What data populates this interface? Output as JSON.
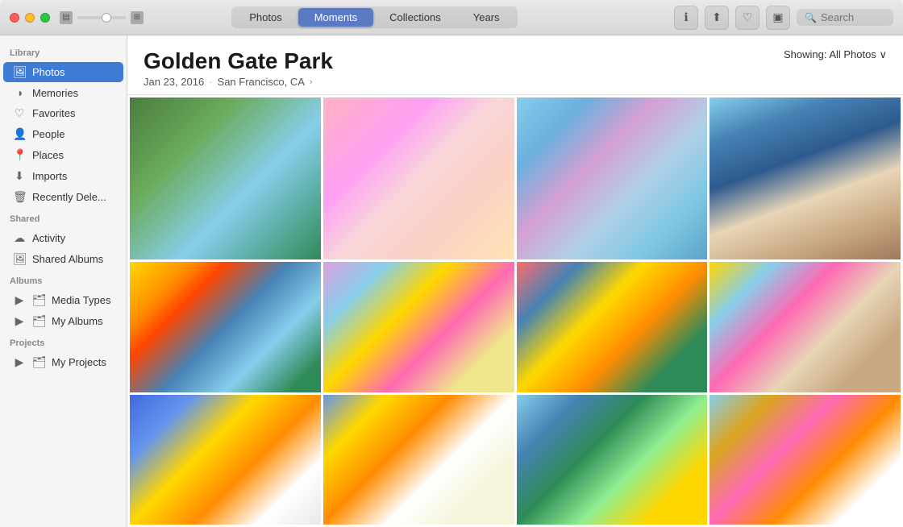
{
  "titlebar": {
    "traffic_lights": [
      "close",
      "minimize",
      "maximize"
    ],
    "tabs": [
      {
        "label": "Photos",
        "active": false
      },
      {
        "label": "Moments",
        "active": true
      },
      {
        "label": "Collections",
        "active": false
      },
      {
        "label": "Years",
        "active": false
      }
    ],
    "toolbar_buttons": [
      {
        "name": "info-icon",
        "icon": "ℹ"
      },
      {
        "name": "share-icon",
        "icon": "⬆"
      },
      {
        "name": "favorite-icon",
        "icon": "♡"
      },
      {
        "name": "slideshow-icon",
        "icon": "⬜"
      }
    ],
    "search_placeholder": "Search"
  },
  "sidebar": {
    "sections": [
      {
        "label": "Library",
        "items": [
          {
            "id": "photos",
            "label": "Photos",
            "icon": "🖼",
            "active": true
          },
          {
            "id": "memories",
            "label": "Memories",
            "icon": "◑"
          },
          {
            "id": "favorites",
            "label": "Favorites",
            "icon": "♡"
          },
          {
            "id": "people",
            "label": "People",
            "icon": "👤"
          },
          {
            "id": "places",
            "label": "Places",
            "icon": "📍"
          },
          {
            "id": "imports",
            "label": "Imports",
            "icon": "⬇"
          },
          {
            "id": "recently-deleted",
            "label": "Recently Dele...",
            "icon": "🗑"
          }
        ]
      },
      {
        "label": "Shared",
        "items": [
          {
            "id": "activity",
            "label": "Activity",
            "icon": "☁"
          },
          {
            "id": "shared-albums",
            "label": "Shared Albums",
            "icon": "🖼"
          }
        ]
      },
      {
        "label": "Albums",
        "items": [
          {
            "id": "media-types",
            "label": "Media Types",
            "icon": "▷",
            "expandable": true
          },
          {
            "id": "my-albums",
            "label": "My Albums",
            "icon": "▷",
            "expandable": true
          }
        ]
      },
      {
        "label": "Projects",
        "items": [
          {
            "id": "my-projects",
            "label": "My Projects",
            "icon": "▷",
            "expandable": true
          }
        ]
      }
    ]
  },
  "content": {
    "title": "Golden Gate Park",
    "date": "Jan 23, 2016",
    "separator": "·",
    "location": "San Francisco, CA",
    "showing_label": "Showing: All Photos",
    "photos": [
      {
        "id": "p1",
        "row": 1
      },
      {
        "id": "p2",
        "row": 1
      },
      {
        "id": "p3",
        "row": 1
      },
      {
        "id": "p4",
        "row": 1
      },
      {
        "id": "p5",
        "row": 2
      },
      {
        "id": "p6",
        "row": 2
      },
      {
        "id": "p7",
        "row": 2
      },
      {
        "id": "p8",
        "row": 2
      },
      {
        "id": "p9",
        "row": 3
      },
      {
        "id": "p10",
        "row": 3
      },
      {
        "id": "p11",
        "row": 3
      },
      {
        "id": "p12",
        "row": 3
      }
    ]
  }
}
